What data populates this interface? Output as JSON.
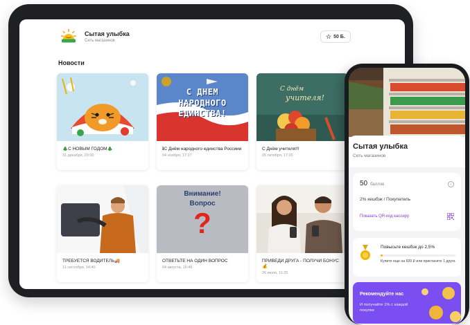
{
  "tablet": {
    "brand_title": "Сытая улыбка",
    "brand_subtitle": "Сеть магазинов",
    "points_label": "50 Б.",
    "section_title": "Новости",
    "news": [
      {
        "title": "🎄С НОВЫМ ГОДОМ🎄",
        "date": "31 декабря, 20:00"
      },
      {
        "title": "ℹС Днём народного единства Россиии",
        "date": "04 ноября, 17:27"
      },
      {
        "title": "С Днём учителя!!!",
        "date": "05 октября, 17:20"
      },
      {
        "title": "ТРЕБУЕТСЯ ВОДИТЕЛЬ🚚",
        "date": "11 сентября, 14:40"
      },
      {
        "title": "ОТВЕТЬТЕ НА ОДИН ВОПРОС",
        "date": "04 августа, 16:46"
      },
      {
        "title": "ПРИВЕДИ ДРУГА - ПОЛУЧИ БОНУС💰",
        "date": "26 июля, 11:25"
      }
    ],
    "image_text": {
      "unity": [
        "С ДНЕМ",
        "НАРОДНОГО",
        "ЕДИНСТВА!"
      ],
      "teacher": [
        "С днём",
        "учителя!"
      ],
      "attention": [
        "Внимание!",
        "Вопрос"
      ],
      "question_mark": "?"
    }
  },
  "phone": {
    "title": "Сытая улыбка",
    "subtitle": "Сеть магазинов",
    "balance_value": "50",
    "balance_unit": "баллов",
    "info_icon": "i",
    "cashback": "2% кешбэк / Покупатель",
    "qr_link": "Показать QR-код кассиру",
    "upgrade_title": "Повысьте кешбэк до 2,5%",
    "upgrade_progress": 0.03,
    "upgrade_note": "Купите еще на 600 ₽ или пригласите 1 друга",
    "promo_title": "Рекомендуйте нас",
    "promo_text": "И получайте 1% с каждой покупки"
  },
  "colors": {
    "accent_purple": "#7a4ef0",
    "link_purple": "#7b3fd1",
    "progress_yellow": "#f2b600",
    "device_frame": "#1f2024"
  },
  "icons": [
    "sun-logo-icon",
    "star-icon",
    "info-icon",
    "qr-code-icon",
    "medal-icon"
  ]
}
